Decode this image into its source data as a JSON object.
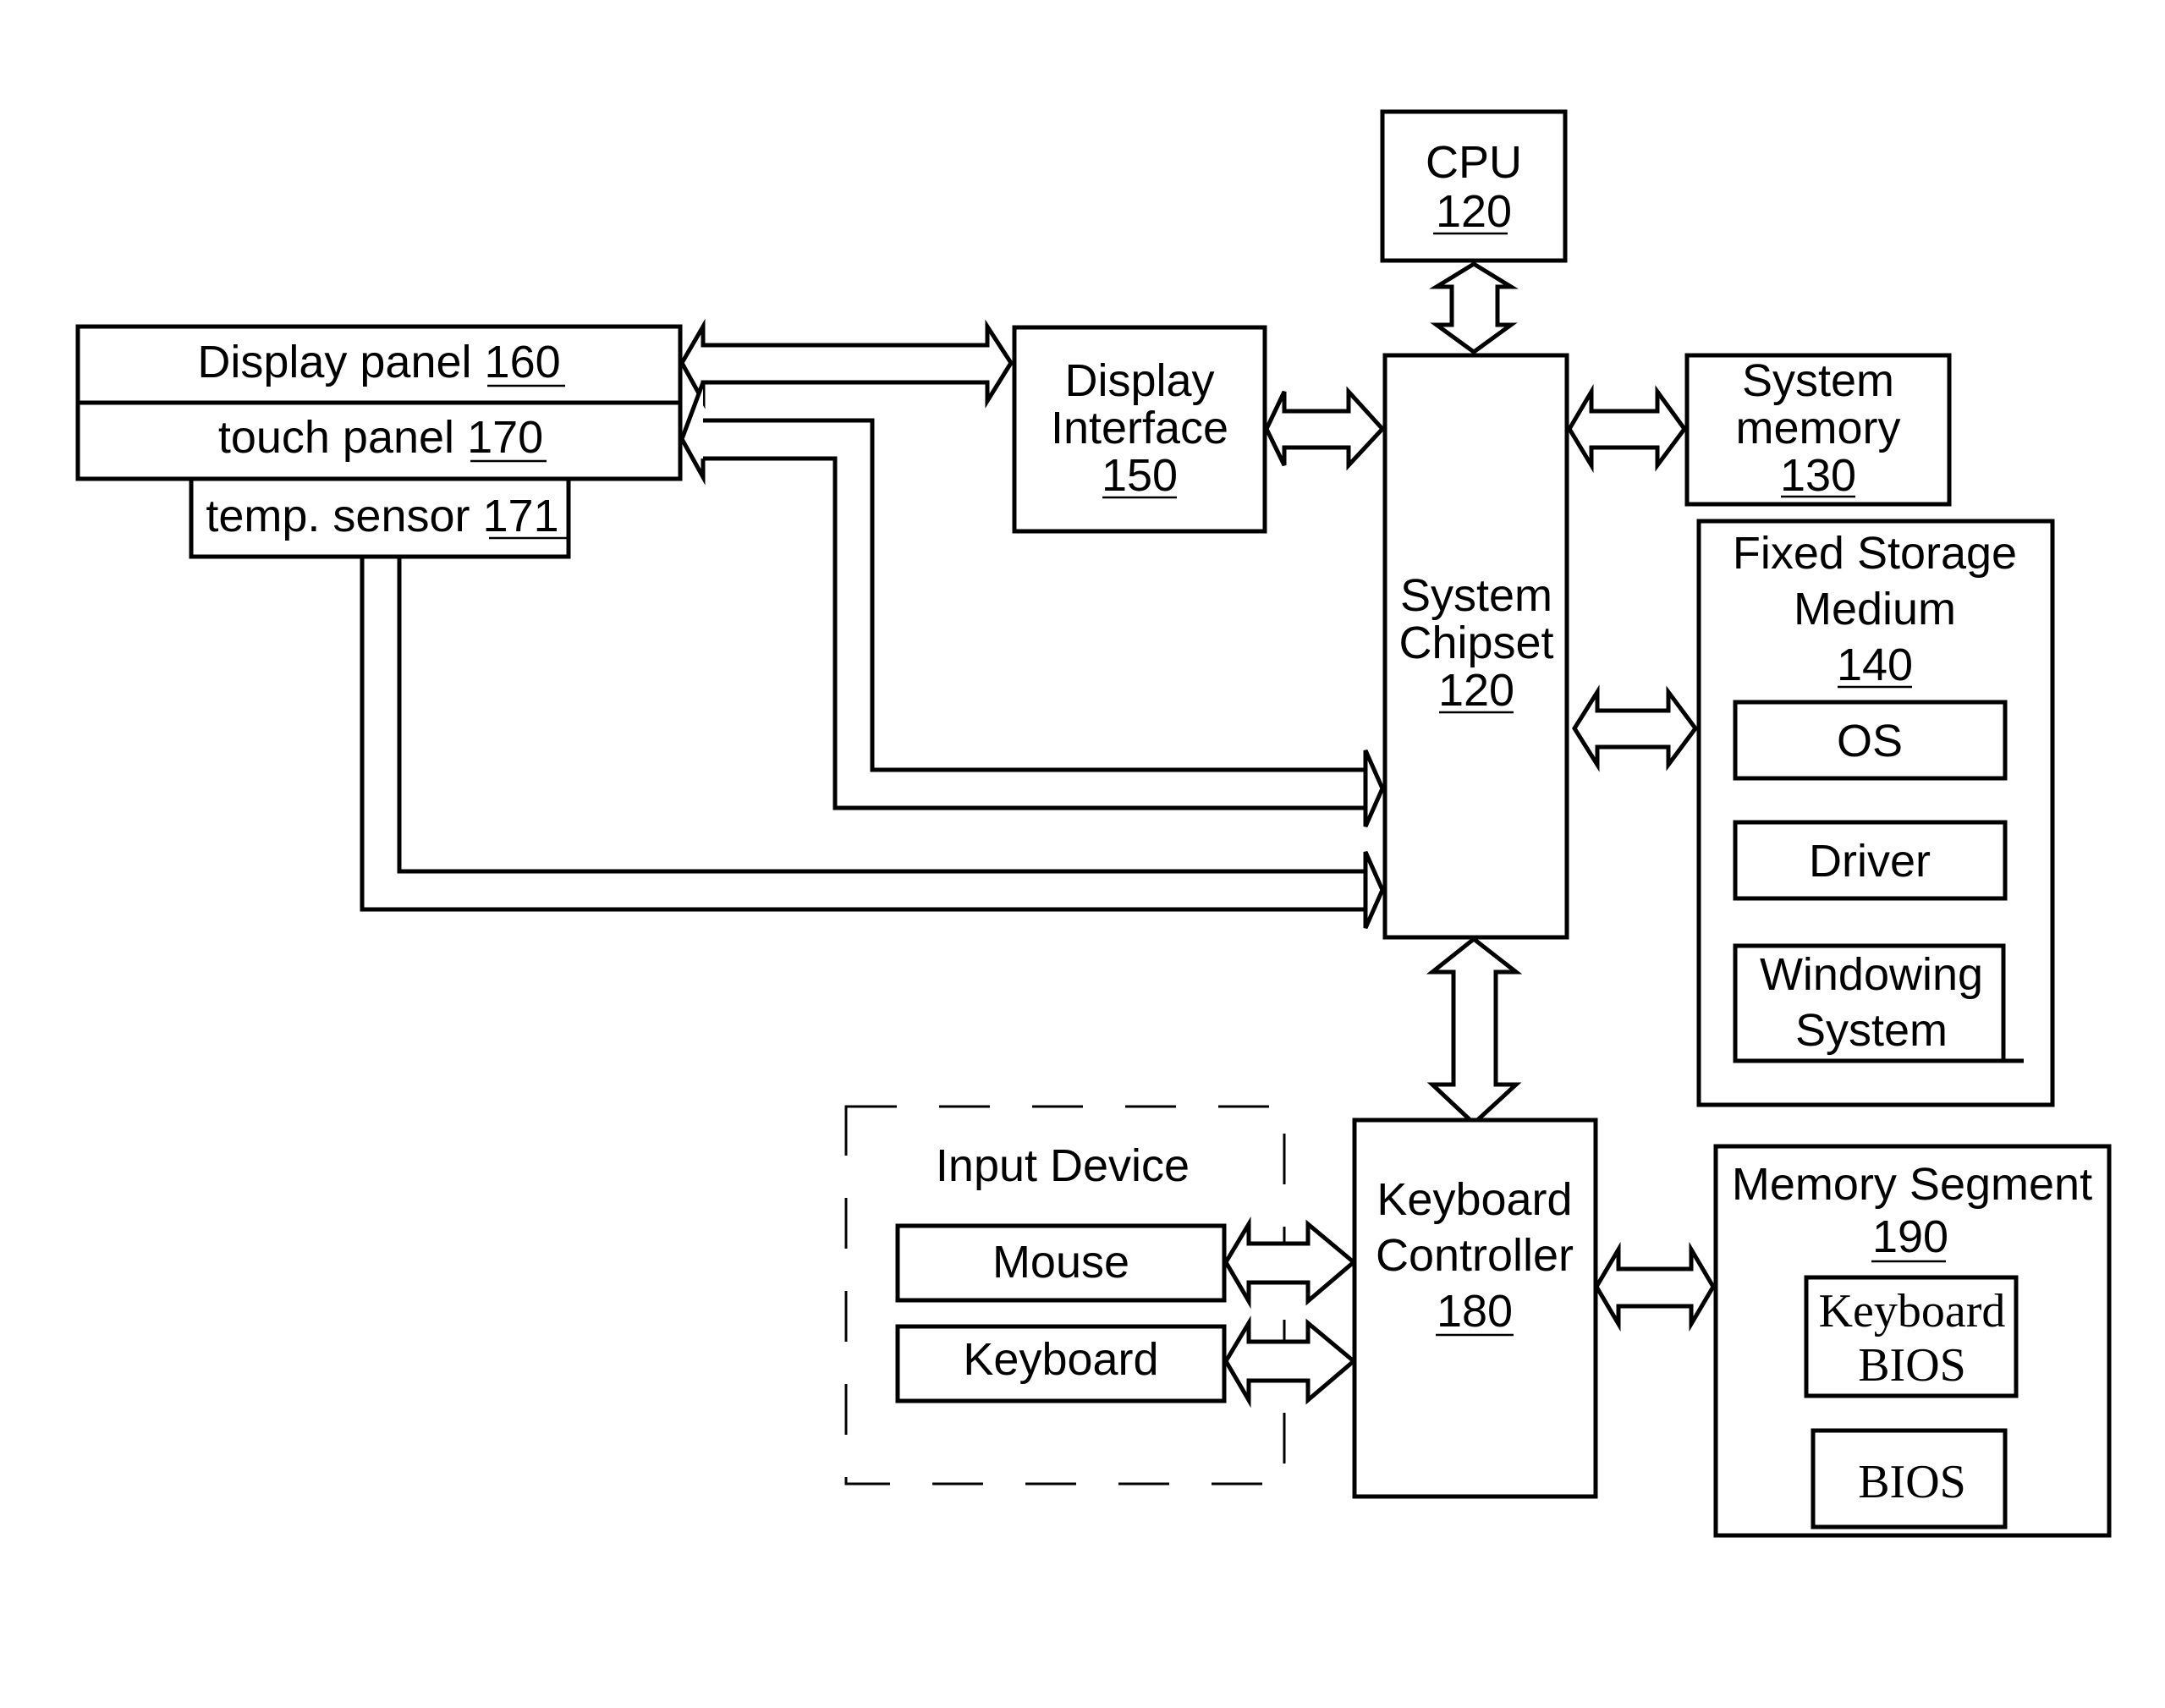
{
  "diagram": {
    "blocks": {
      "cpu": {
        "name": "CPU",
        "ref": "120"
      },
      "system_chipset": {
        "lines": [
          "System",
          "Chipset"
        ],
        "ref": "120"
      },
      "system_memory": {
        "lines": [
          "System",
          "memory"
        ],
        "ref": "130"
      },
      "fixed_storage": {
        "lines": [
          "Fixed Storage",
          "Medium"
        ],
        "ref": "140"
      },
      "os": {
        "name": "OS"
      },
      "driver": {
        "name": "Driver"
      },
      "windowing_system": {
        "lines": [
          "Windowing",
          "System"
        ]
      },
      "display_interface": {
        "lines": [
          "Display",
          "Interface"
        ],
        "ref": "150"
      },
      "display_panel": {
        "name": "Display panel",
        "ref": "160"
      },
      "touch_panel": {
        "name": "touch panel",
        "ref": "170"
      },
      "temp_sensor": {
        "name": "temp. sensor",
        "ref": "171"
      },
      "input_device": {
        "name": "Input Device"
      },
      "mouse": {
        "name": "Mouse"
      },
      "keyboard": {
        "name": "Keyboard"
      },
      "keyboard_controller": {
        "lines": [
          "Keyboard",
          "Controller"
        ],
        "ref": "180"
      },
      "memory_segment": {
        "name": "Memory Segment",
        "ref": "190"
      },
      "keyboard_bios": {
        "lines": [
          "Keyboard",
          "BIOS"
        ]
      },
      "bios": {
        "name": "BIOS"
      }
    },
    "connections": [
      {
        "from": "CPU",
        "to": "System Chipset",
        "type": "bidirectional"
      },
      {
        "from": "System Chipset",
        "to": "System memory",
        "type": "bidirectional"
      },
      {
        "from": "System Chipset",
        "to": "Fixed Storage Medium",
        "type": "bidirectional"
      },
      {
        "from": "Display Interface",
        "to": "System Chipset",
        "type": "bidirectional"
      },
      {
        "from": "Display panel",
        "to": "Display Interface",
        "type": "bidirectional"
      },
      {
        "from": "touch panel",
        "to": "System Chipset",
        "type": "bidirectional"
      },
      {
        "from": "temp. sensor",
        "to": "System Chipset",
        "type": "unidirectional"
      },
      {
        "from": "System Chipset",
        "to": "Keyboard Controller",
        "type": "bidirectional"
      },
      {
        "from": "Mouse",
        "to": "Keyboard Controller",
        "type": "bidirectional"
      },
      {
        "from": "Keyboard",
        "to": "Keyboard Controller",
        "type": "bidirectional"
      },
      {
        "from": "Keyboard Controller",
        "to": "Memory Segment",
        "type": "bidirectional"
      }
    ]
  }
}
